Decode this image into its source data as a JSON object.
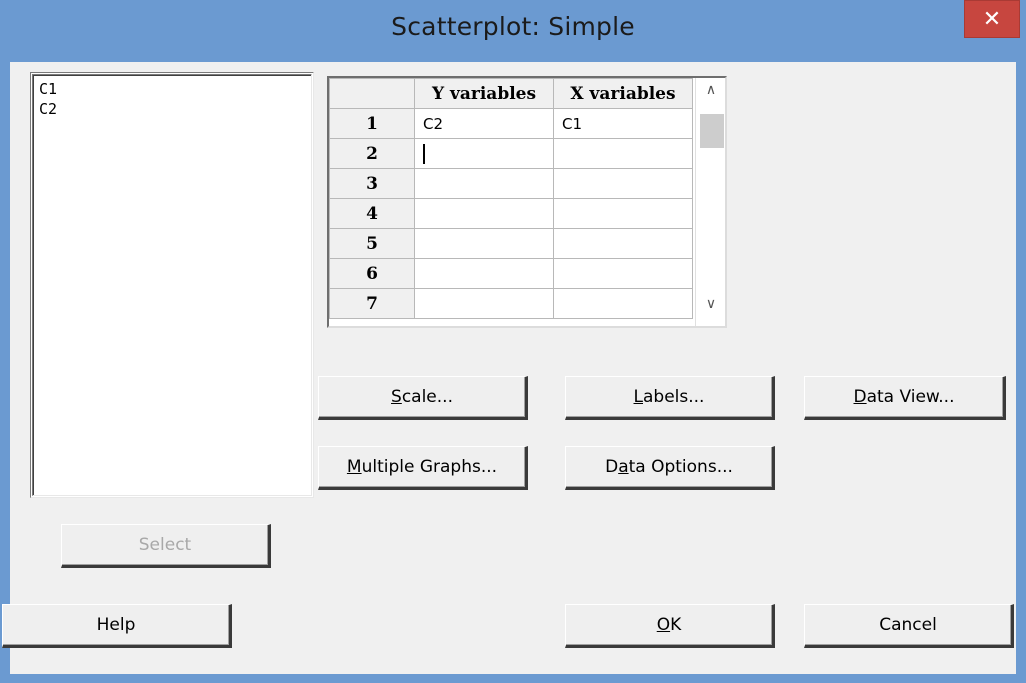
{
  "window": {
    "title": "Scatterplot: Simple",
    "close_glyph": "✕"
  },
  "variables": [
    "C1",
    "C2"
  ],
  "grid": {
    "columns": [
      "Y variables",
      "X variables"
    ],
    "rows": [
      {
        "n": "1",
        "y": "C2",
        "x": "C1"
      },
      {
        "n": "2",
        "y": "",
        "x": ""
      },
      {
        "n": "3",
        "y": "",
        "x": ""
      },
      {
        "n": "4",
        "y": "",
        "x": ""
      },
      {
        "n": "5",
        "y": "",
        "x": ""
      },
      {
        "n": "6",
        "y": "",
        "x": ""
      },
      {
        "n": "7",
        "y": "",
        "x": ""
      }
    ],
    "scroll_up_glyph": "∧",
    "scroll_down_glyph": "∨"
  },
  "buttons": {
    "select": "Select",
    "help": "Help",
    "scale": {
      "u": "S",
      "rest": "cale..."
    },
    "labels": {
      "u": "L",
      "rest": "abels..."
    },
    "data_view": {
      "u": "D",
      "rest": "ata View..."
    },
    "multiple_graphs": {
      "u": "M",
      "rest": "ultiple Graphs..."
    },
    "data_options": {
      "pre": "D",
      "u": "a",
      "rest": "ta Options..."
    },
    "ok": {
      "u": "O",
      "rest": "K"
    },
    "cancel": "Cancel"
  }
}
